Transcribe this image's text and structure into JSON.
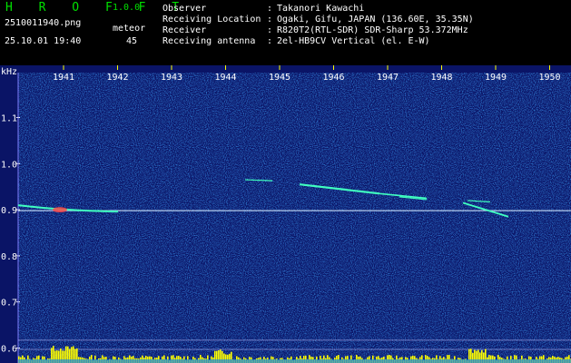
{
  "header": {
    "app_title": "H R O F F T",
    "version": "1.0.0",
    "filename": "2510011940.png",
    "datetime": "25.10.01 19:40",
    "meteor_label": "meteor",
    "meteor_count": "45"
  },
  "info": [
    {
      "label": "Observer",
      "value": "Takanori Kawachi"
    },
    {
      "label": "Receiving Location",
      "value": "Ogaki, Gifu, JAPAN (136.60E, 35.35N)"
    },
    {
      "label": "Receiver",
      "value": "R820T2(RTL-SDR) SDR-Sharp 53.372MHz"
    },
    {
      "label": "Receiving antenna",
      "value": "2el-HB9CV Vertical (el. E-W)"
    }
  ],
  "separator": ":",
  "spectrogram": {
    "y_unit": "kHz",
    "time_ticks": [
      "1941",
      "1942",
      "1943",
      "1944",
      "1945",
      "1946",
      "1947",
      "1948",
      "1949",
      "1950"
    ],
    "freq_ticks": [
      "1.1",
      "1.0",
      "0.9",
      "0.8",
      "0.7",
      "0.6"
    ],
    "freq_range": [
      0.58,
      1.2
    ],
    "colors": {
      "background": "#0a1466",
      "carrier": "#d0e8ff",
      "echo": "#40ffc0",
      "head": "#ff4040",
      "activity": "#ffff00",
      "baseline": "#0080ff"
    }
  }
}
